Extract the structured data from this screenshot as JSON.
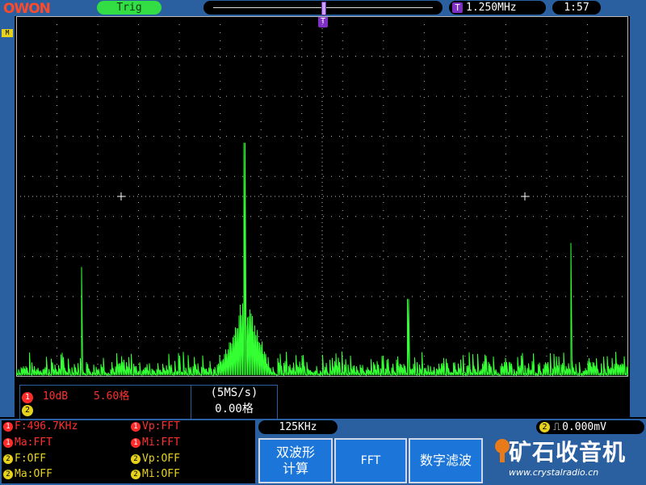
{
  "top_bar": {
    "logo": "OWON",
    "trigger_status": "Trig",
    "trigger_marker": "T",
    "trigger_frequency": "1.250MHz",
    "clock": "1:57"
  },
  "channel_marker": "M",
  "plot": {
    "waveform_color": "#33ff33",
    "grid_color": "#bbbbbb",
    "h_divisions": 15,
    "v_divisions": 9,
    "fft_peaks": [
      {
        "x_div": 1.6,
        "height_div": 2.7
      },
      {
        "x_div": 5.6,
        "height_div": 5.8
      },
      {
        "x_div": 9.6,
        "height_div": 1.9
      },
      {
        "x_div": 13.6,
        "height_div": 3.3
      }
    ],
    "noise_floor_div": 0.6
  },
  "info_panel": {
    "ch1_number": "1",
    "ch1_scale": "10dB",
    "ch1_position": "5.60格",
    "ch2_number": "2",
    "sample_rate": "(5MS/s)",
    "horizontal_position": "0.00格"
  },
  "measurements": [
    {
      "ch": "1",
      "text": "F:496.7KHz",
      "color": "red"
    },
    {
      "ch": "1",
      "text": "Vp:FFT",
      "color": "red"
    },
    {
      "ch": "1",
      "text": "Ma:FFT",
      "color": "red"
    },
    {
      "ch": "1",
      "text": "Mi:FFT",
      "color": "red"
    },
    {
      "ch": "2",
      "text": "F:OFF",
      "color": "yellow"
    },
    {
      "ch": "2",
      "text": "Vp:OFF",
      "color": "yellow"
    },
    {
      "ch": "2",
      "text": "Ma:OFF",
      "color": "yellow"
    },
    {
      "ch": "2",
      "text": "Mi:OFF",
      "color": "yellow"
    }
  ],
  "timebase": "125KHz",
  "trigger_level": {
    "ch": "2",
    "text": "0.000mV"
  },
  "softkeys": [
    {
      "label": "双波形\n计算"
    },
    {
      "label": "FFT"
    },
    {
      "label": "数字滤波"
    }
  ],
  "watermark": {
    "name": "矿石收音机",
    "url": "www.crystalradio.cn"
  }
}
